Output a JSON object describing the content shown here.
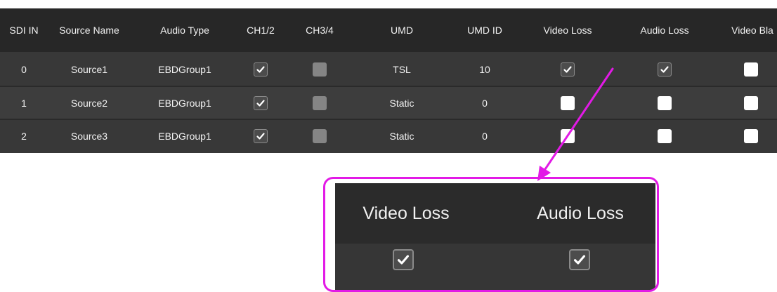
{
  "table": {
    "headers": [
      "SDI IN",
      "Source Name",
      "Audio Type",
      "CH1/2",
      "CH3/4",
      "UMD",
      "UMD ID",
      "Video Loss",
      "Audio Loss",
      "Video Bla"
    ],
    "rows": [
      {
        "sdi_in": "0",
        "source_name": "Source1",
        "audio_type": "EBDGroup1",
        "ch12": "checked",
        "ch34": "disabled",
        "umd": "TSL",
        "umd_id": "10",
        "video_loss": "checked",
        "audio_loss": "checked",
        "video_black": "unchecked"
      },
      {
        "sdi_in": "1",
        "source_name": "Source2",
        "audio_type": "EBDGroup1",
        "ch12": "checked",
        "ch34": "disabled",
        "umd": "Static",
        "umd_id": "0",
        "video_loss": "unchecked",
        "audio_loss": "unchecked",
        "video_black": "unchecked"
      },
      {
        "sdi_in": "2",
        "source_name": "Source3",
        "audio_type": "EBDGroup1",
        "ch12": "checked",
        "ch34": "disabled",
        "umd": "Static",
        "umd_id": "0",
        "video_loss": "unchecked",
        "audio_loss": "unchecked",
        "video_black": "unchecked"
      }
    ]
  },
  "zoom": {
    "headers": [
      "Video Loss",
      "Audio Loss"
    ],
    "values": [
      "checked",
      "checked"
    ]
  },
  "colors": {
    "highlight": "#e21ae6",
    "header_bg": "#272727",
    "row_bg": "#383838",
    "checkbox_checked_bg": "#4c4c4c",
    "checkbox_unchecked_bg": "#ffffff",
    "checkbox_disabled_bg": "#858585"
  },
  "icons": {
    "check": "checkmark-icon",
    "arrow": "annotation-arrow"
  }
}
